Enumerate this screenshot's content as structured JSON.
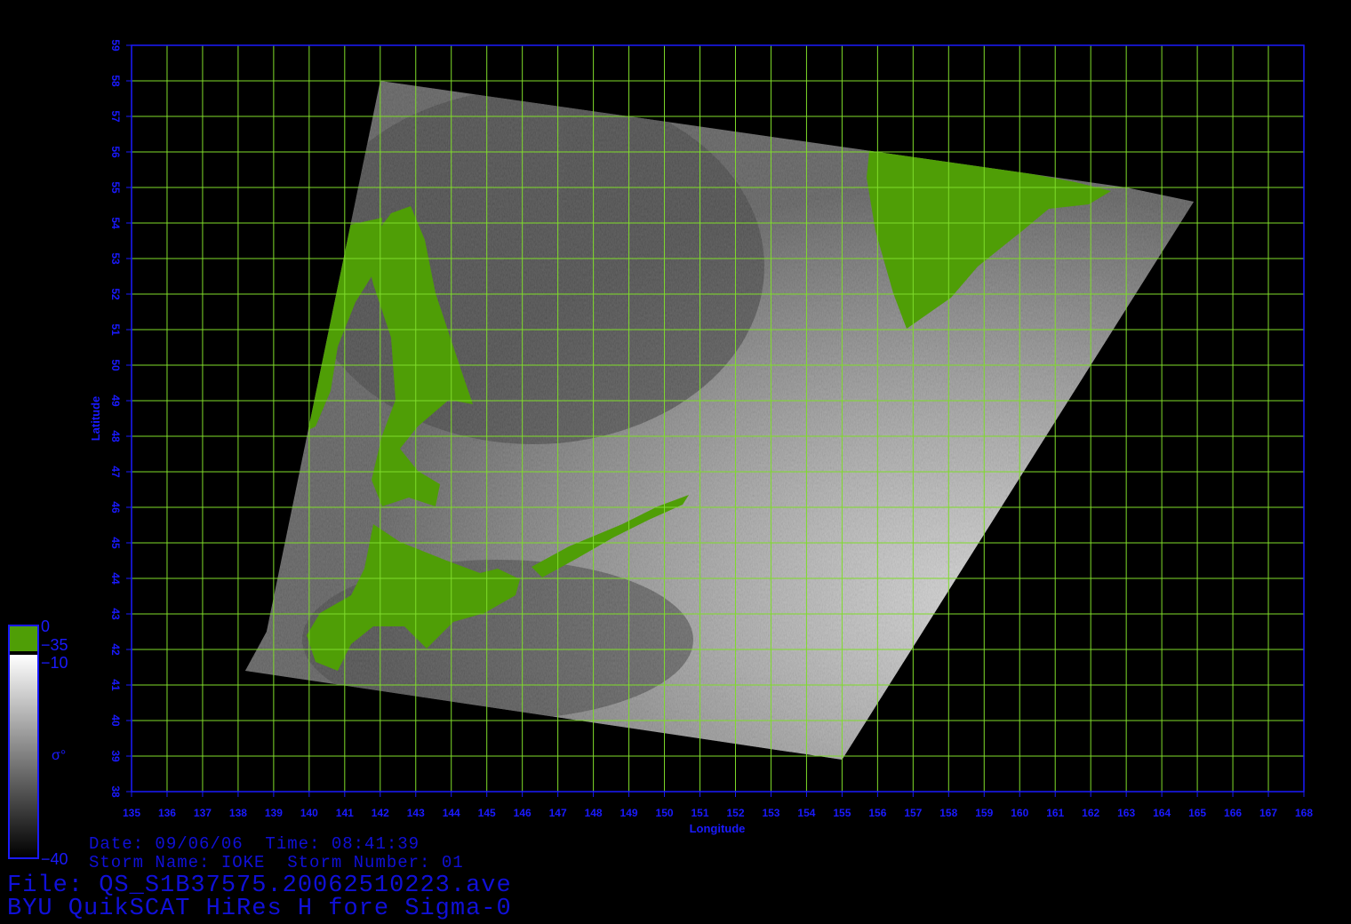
{
  "map": {
    "lon_range": [
      135,
      168
    ],
    "lat_range": [
      38,
      59
    ],
    "lon_ticks": [
      135,
      136,
      137,
      138,
      139,
      140,
      141,
      142,
      143,
      144,
      145,
      146,
      147,
      148,
      149,
      150,
      151,
      152,
      153,
      154,
      155,
      156,
      157,
      158,
      159,
      160,
      161,
      162,
      163,
      164,
      165,
      166,
      167,
      168
    ],
    "lat_ticks": [
      38,
      39,
      40,
      41,
      42,
      43,
      44,
      45,
      46,
      47,
      48,
      49,
      50,
      51,
      52,
      53,
      54,
      55,
      56,
      57,
      58,
      59
    ],
    "x_axis_label": "Longitude",
    "y_axis_label": "Latitude",
    "grid": true,
    "swath_corners_lonlat": [
      [
        142.0,
        58.0
      ],
      [
        163.0,
        55.0
      ],
      [
        164.9,
        54.6
      ],
      [
        155.0,
        38.9
      ],
      [
        138.2,
        41.4
      ],
      [
        138.8,
        42.5
      ]
    ],
    "land_color": "#4f9e06",
    "grid_color": "#7fdc2a",
    "axis_color": "#1a1aff"
  },
  "colorbar": {
    "label": "σ°",
    "ticks": [
      "0",
      "−35",
      "−10",
      "−40"
    ],
    "land_color": "#4f9e06"
  },
  "info": {
    "date_line": "Date: 09/06/06  Time: 08:41:39",
    "storm_line": "Storm Name: IOKE  Storm Number: 01",
    "file_line": "File: QS_S1B37575.20062510223.ave",
    "product_line": "BYU QuikSCAT HiRes H fore Sigma-0"
  }
}
